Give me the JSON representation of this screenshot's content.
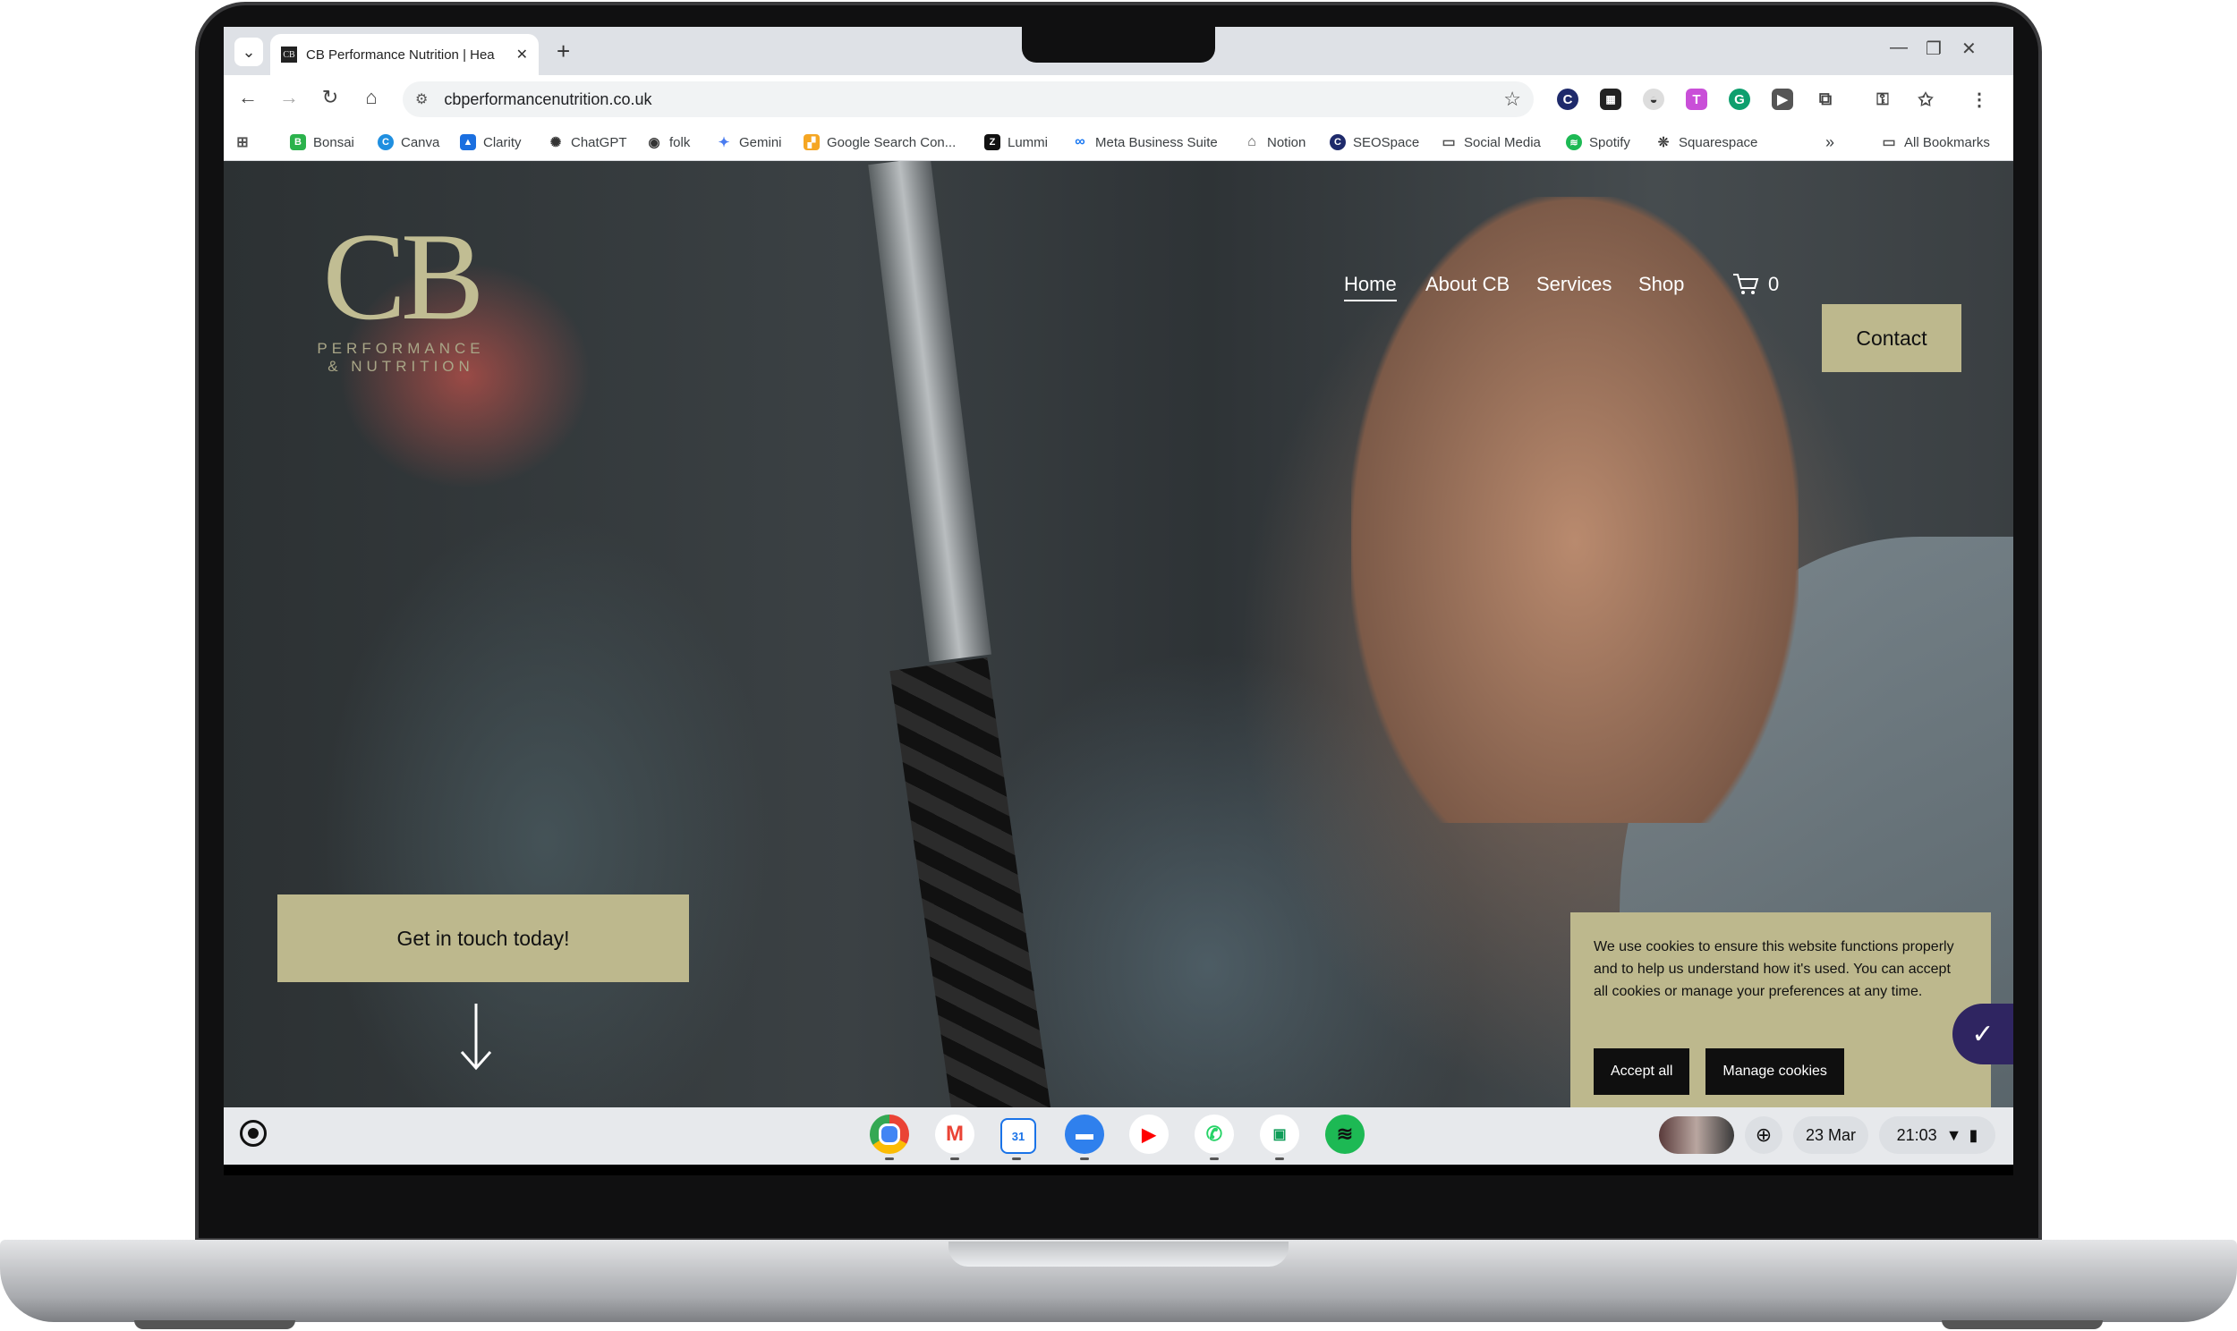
{
  "browser": {
    "tab_title": "CB Performance Nutrition | Hea",
    "tab_favicon": "CB",
    "url": "cbperformancenutrition.co.uk",
    "bookmarks": [
      "Bonsai",
      "Canva",
      "Clarity",
      "ChatGPT",
      "folk",
      "Gemini",
      "Google Search Con...",
      "Lummi",
      "Meta Business Suite",
      "Notion",
      "SEOSpace",
      "Social Media",
      "Spotify",
      "Squarespace"
    ],
    "all_bookmarks": "All Bookmarks",
    "overflow": "»"
  },
  "site": {
    "logo_main": "CB",
    "logo_sub1": "PERFORMANCE",
    "logo_sub2": "& NUTRITION",
    "nav": [
      "Home",
      "About CB",
      "Services",
      "Shop"
    ],
    "cart_count": "0",
    "contact": "Contact",
    "cta": "Get in touch today!",
    "accent": "#bdb88d"
  },
  "cookie": {
    "text": "We use cookies to ensure this website functions properly and to help us understand how it's used. You can accept all cookies or manage your preferences at any time.",
    "accept": "Accept all",
    "manage": "Manage cookies"
  },
  "shelf": {
    "date": "23 Mar",
    "time": "21:03",
    "calendar_day": "31"
  }
}
